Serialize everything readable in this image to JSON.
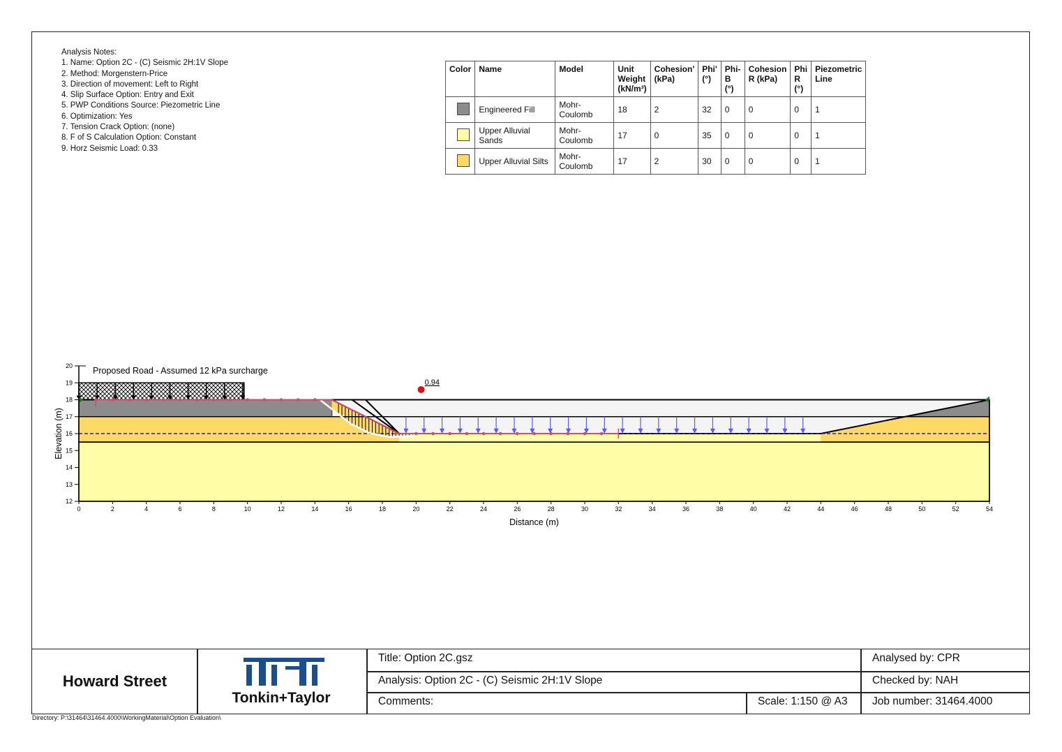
{
  "analysis_notes": {
    "heading": "Analysis Notes:",
    "lines": [
      "1. Name: Option 2C - (C) Seismic 2H:1V Slope",
      "2. Method: Morgenstern-Price",
      "3. Direction of movement: Left to Right",
      "4. Slip Surface Option: Entry and Exit",
      "5. PWP Conditions Source: Piezometric Line",
      "6. Optimization: Yes",
      "7. Tension Crack Option: (none)",
      "8. F of S Calculation Option: Constant",
      "9. Horz Seismic Load: 0.33"
    ]
  },
  "materials_table": {
    "headers": [
      "Color",
      "Name",
      "Model",
      "Unit Weight (kN/m³)",
      "Cohesion' (kPa)",
      "Phi' (°)",
      "Phi-B (°)",
      "Cohesion R (kPa)",
      "Phi R (°)",
      "Piezometric Line"
    ],
    "rows": [
      {
        "color": "#8c8c8c",
        "name": "Engineered Fill",
        "model": "Mohr-Coulomb",
        "unit_weight": "18",
        "cohesion": "2",
        "phi": "32",
        "phi_b": "0",
        "cohesion_r": "0",
        "phi_r": "0",
        "piezo": "1"
      },
      {
        "color": "#ffffa8",
        "name": "Upper Alluvial Sands",
        "model": "Mohr-Coulomb",
        "unit_weight": "17",
        "cohesion": "0",
        "phi": "35",
        "phi_b": "0",
        "cohesion_r": "0",
        "phi_r": "0",
        "piezo": "1"
      },
      {
        "color": "#ffd966",
        "name": "Upper Alluvial Silts",
        "model": "Mohr-Coulomb",
        "unit_weight": "17",
        "cohesion": "2",
        "phi": "30",
        "phi_b": "0",
        "cohesion_r": "0",
        "phi_r": "0",
        "piezo": "1"
      }
    ]
  },
  "section": {
    "surcharge_label": "Proposed Road - Assumed 12 kPa surcharge",
    "factor_of_safety": "0.94",
    "xlabel": "Distance (m)",
    "ylabel": "Elevation (m)",
    "xlim": [
      0,
      54
    ],
    "ylim": [
      12,
      20
    ],
    "x_ticks": [
      0,
      2,
      4,
      6,
      8,
      10,
      12,
      14,
      16,
      18,
      20,
      22,
      24,
      26,
      28,
      30,
      32,
      34,
      36,
      38,
      40,
      42,
      44,
      46,
      48,
      50,
      52,
      54
    ],
    "y_ticks": [
      12,
      13,
      14,
      15,
      16,
      17,
      18,
      19,
      20
    ],
    "water_level": 16,
    "surcharge_extent": [
      0,
      9.8
    ],
    "slip_entry": 14.3,
    "slip_exit": 21,
    "critical_center": [
      20.3,
      18.6
    ],
    "excavation_load_range": [
      19.4,
      43.4
    ],
    "colors": {
      "fill": "#8c8c8c",
      "sands": "#ffffa8",
      "silts": "#ffd966",
      "excavated": "#f4f4f4",
      "water": "#1a1aff",
      "slip": "#c8506a",
      "load_arrow": "#5a5aff",
      "fos_point": "#e01010"
    }
  },
  "title_block": {
    "project": "Howard Street",
    "company": "Tonkin+Taylor",
    "title": "Title: Option 2C.gsz",
    "analysis": "Analysis: Option 2C - (C) Seismic 2H:1V Slope",
    "comments": "Comments:",
    "scale": "Scale: 1:150 @ A3",
    "analysed_by": "Analysed by: CPR",
    "checked_by": "Checked by: NAH",
    "job_number": "Job number: 31464.4000"
  },
  "directory": "Directory: P:\\31464\\31464.4000\\WorkingMaterial\\Option Evaluation\\"
}
